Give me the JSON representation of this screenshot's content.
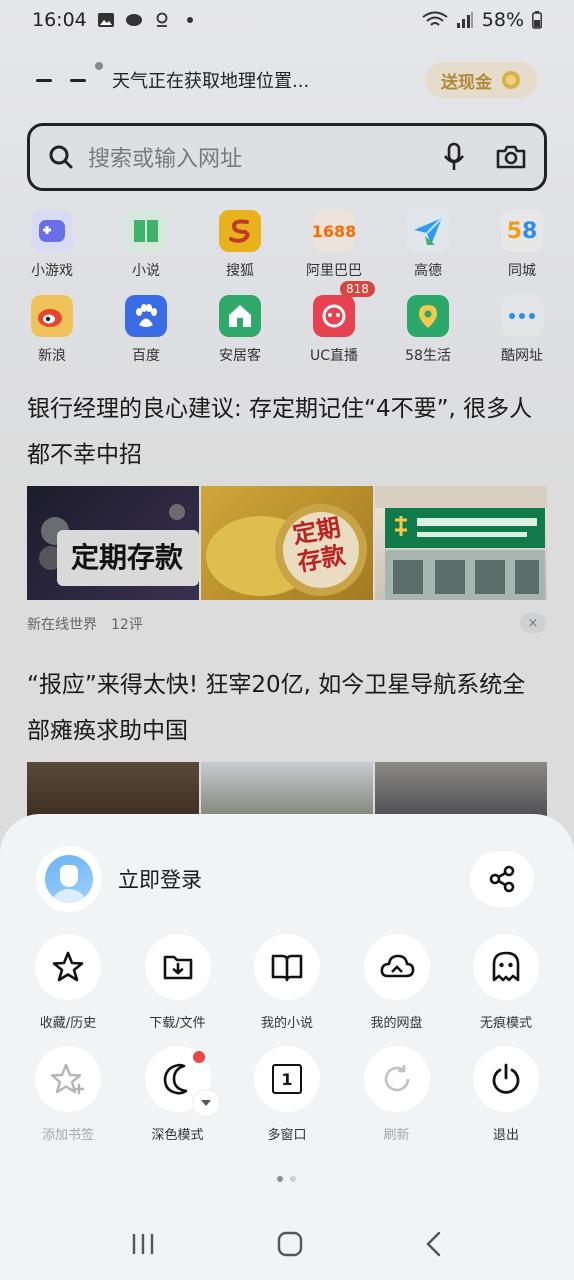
{
  "status_bar": {
    "time": "16:04",
    "battery": "58%"
  },
  "header": {
    "weather": "天气正在获取地理位置...",
    "cash_label": "送现金"
  },
  "search": {
    "placeholder": "搜索或输入网址"
  },
  "quick_links_row1": [
    {
      "label": "小游戏",
      "color": "#6a6fe8"
    },
    {
      "label": "小说",
      "color": "#3fb36a"
    },
    {
      "label": "搜狐",
      "color": "#e8b21c"
    },
    {
      "label": "阿里巴巴",
      "color": "#ff6a00"
    },
    {
      "label": "高德",
      "color": "#2e9bf0"
    },
    {
      "label": "同城",
      "color": "#ff5a2b"
    }
  ],
  "quick_links_row2": [
    {
      "label": "新浪",
      "color": "#e8452f"
    },
    {
      "label": "百度",
      "color": "#3a6ce6"
    },
    {
      "label": "安居客",
      "color": "#2ea86b"
    },
    {
      "label": "UC直播",
      "color": "#e8414f",
      "badge": "818"
    },
    {
      "label": "58生活",
      "color": "#2aa86a"
    },
    {
      "label": "酷网址",
      "color": "#2d8cf0"
    }
  ],
  "news": [
    {
      "title": "银行经理的良心建议: 存定期记住“4不要”, 很多人都不幸中招",
      "img1_text": "定期存款",
      "img2_text": "定期存款",
      "source": "新在线世界",
      "comments": "12评",
      "close": "×"
    },
    {
      "title": "“报应”来得太快! 狂宰20亿, 如今卫星导航系统全部瘫痪求助中国"
    }
  ],
  "sheet": {
    "login_label": "立即登录",
    "row1": [
      {
        "label": "收藏/历史",
        "icon": "star-icon"
      },
      {
        "label": "下载/文件",
        "icon": "download-folder-icon"
      },
      {
        "label": "我的小说",
        "icon": "book-icon"
      },
      {
        "label": "我的网盘",
        "icon": "cloud-icon"
      },
      {
        "label": "无痕模式",
        "icon": "ghost-icon"
      }
    ],
    "row2": [
      {
        "label": "添加书签",
        "icon": "add-bookmark-icon",
        "disabled": true
      },
      {
        "label": "深色模式",
        "icon": "moon-icon"
      },
      {
        "label": "多窗口",
        "icon": "windows-icon",
        "count": "1"
      },
      {
        "label": "刷新",
        "icon": "refresh-icon",
        "disabled": true
      },
      {
        "label": "退出",
        "icon": "power-icon"
      }
    ]
  }
}
